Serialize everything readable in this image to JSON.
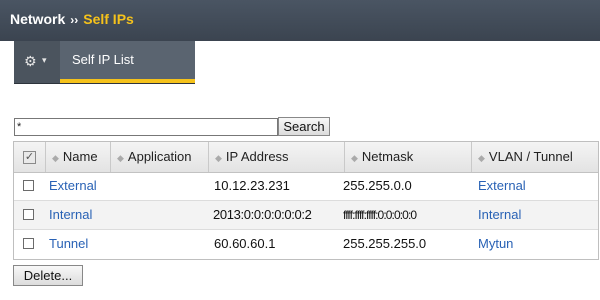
{
  "header": {
    "section": "Network",
    "separator": "››",
    "current_page": "Self IPs"
  },
  "tabs": {
    "gear_icon": "gear-icon",
    "gear_caret": "▾",
    "items": [
      {
        "label": "Self IP List",
        "active": true
      }
    ]
  },
  "search": {
    "value": "*",
    "button_label": "Search"
  },
  "table": {
    "select_all_mark": "✓",
    "sort_icon": "◆",
    "columns": [
      "Name",
      "Application",
      "IP Address",
      "Netmask",
      "VLAN / Tunnel"
    ],
    "rows": [
      {
        "name": "External",
        "application": "",
        "ip_address": "10.12.23.231",
        "netmask": "255.255.0.0",
        "vlan": "External"
      },
      {
        "name": "Internal",
        "application": "",
        "ip_address": "2013:0:0:0:0:0:0:2",
        "netmask": "ffff:ffff:ffff:0:0:0:0:0",
        "vlan": "Internal"
      },
      {
        "name": "Tunnel",
        "application": "",
        "ip_address": "60.60.60.1",
        "netmask": "255.255.255.0",
        "vlan": "Mytun"
      }
    ]
  },
  "actions": {
    "delete_label": "Delete..."
  },
  "colors": {
    "header_bg": "#3f4854",
    "accent": "#f5c21b",
    "link": "#2962b5"
  }
}
